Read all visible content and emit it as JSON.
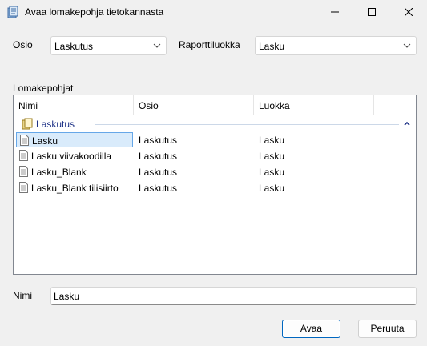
{
  "window": {
    "title": "Avaa lomakepohja tietokannasta"
  },
  "filters": {
    "osio_label": "Osio",
    "osio_value": "Laskutus",
    "raporttiluokka_label": "Raporttiluokka",
    "raporttiluokka_value": "Lasku"
  },
  "templates": {
    "section_label": "Lomakepohjat",
    "columns": [
      "Nimi",
      "Osio",
      "Luokka"
    ],
    "group_name": "Laskutus",
    "rows": [
      {
        "nimi": "Lasku",
        "osio": "Laskutus",
        "luokka": "Lasku",
        "selected": true
      },
      {
        "nimi": "Lasku viivakoodilla",
        "osio": "Laskutus",
        "luokka": "Lasku",
        "selected": false
      },
      {
        "nimi": "Lasku_Blank",
        "osio": "Laskutus",
        "luokka": "Lasku",
        "selected": false
      },
      {
        "nimi": "Lasku_Blank tilisiirto",
        "osio": "Laskutus",
        "luokka": "Lasku",
        "selected": false
      }
    ]
  },
  "name_field": {
    "label": "Nimi",
    "value": "Lasku"
  },
  "buttons": {
    "open_label": "Avaa",
    "cancel_label": "Peruuta"
  },
  "icons": {
    "app": "database-form-icon",
    "minimize": "minimize-icon",
    "maximize": "maximize-icon",
    "close": "close-icon",
    "group": "folder-icon",
    "document": "document-icon"
  },
  "colors": {
    "accent": "#0067c0",
    "selection_bg": "#d9ebfb",
    "selection_border": "#66a7e8",
    "group_text": "#1e3287"
  }
}
